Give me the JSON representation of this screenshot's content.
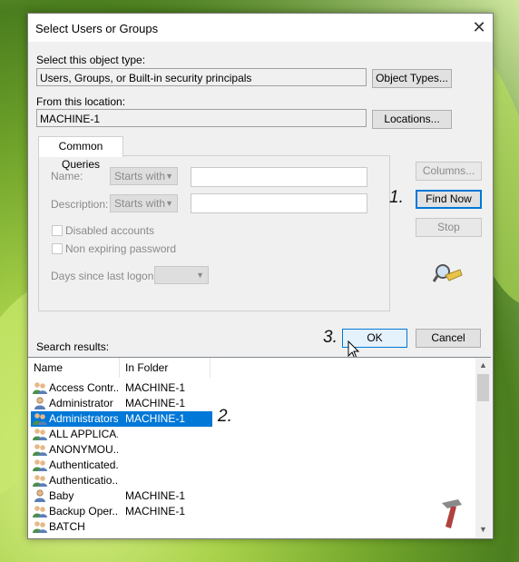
{
  "dialog": {
    "title": "Select Users or Groups"
  },
  "object_type": {
    "label": "Select this object type:",
    "value": "Users, Groups, or Built-in security principals",
    "button": "Object Types..."
  },
  "location": {
    "label": "From this location:",
    "value": "MACHINE-1",
    "button": "Locations..."
  },
  "queries": {
    "tab": "Common Queries",
    "name_label": "Name:",
    "name_op": "Starts with",
    "desc_label": "Description:",
    "desc_op": "Starts with",
    "disabled": "Disabled accounts",
    "nonexpiring": "Non expiring password",
    "days_label": "Days since last logon:"
  },
  "buttons": {
    "columns": "Columns...",
    "find_now": "Find Now",
    "stop": "Stop",
    "ok": "OK",
    "cancel": "Cancel"
  },
  "annotations": {
    "a1": "1.",
    "a2": "2.",
    "a3": "3."
  },
  "results": {
    "label": "Search results:",
    "columns": [
      "Name",
      "In Folder"
    ],
    "rows": [
      {
        "name": "Access Contr...",
        "folder": "MACHINE-1",
        "icon": "group-icon"
      },
      {
        "name": "Administrator",
        "folder": "MACHINE-1",
        "icon": "user-icon"
      },
      {
        "name": "Administrators",
        "folder": "MACHINE-1",
        "icon": "group-icon",
        "selected": true
      },
      {
        "name": "ALL APPLICA...",
        "folder": "",
        "icon": "group-icon"
      },
      {
        "name": "ANONYMOU...",
        "folder": "",
        "icon": "group-icon"
      },
      {
        "name": "Authenticated...",
        "folder": "",
        "icon": "group-icon"
      },
      {
        "name": "Authenticatio...",
        "folder": "",
        "icon": "group-icon"
      },
      {
        "name": "Baby",
        "folder": "MACHINE-1",
        "icon": "user-icon"
      },
      {
        "name": "Backup Oper...",
        "folder": "MACHINE-1",
        "icon": "group-icon"
      },
      {
        "name": "BATCH",
        "folder": "",
        "icon": "group-icon"
      }
    ]
  },
  "colors": {
    "accent": "#0078d7",
    "background": "#f0f0f0"
  }
}
